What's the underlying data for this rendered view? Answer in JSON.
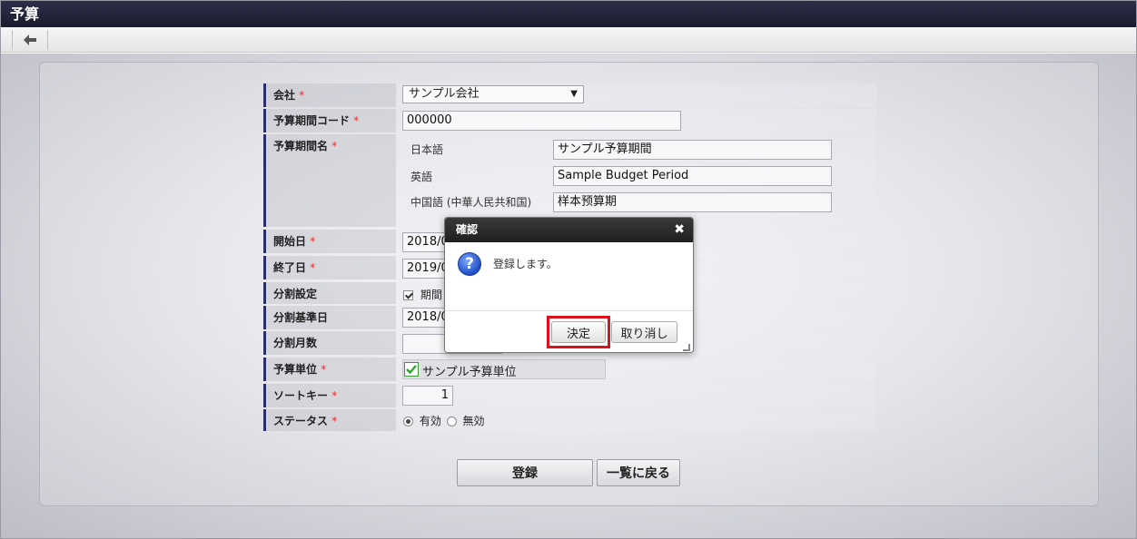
{
  "app": {
    "title": "予算"
  },
  "form": {
    "company": {
      "label": "会社",
      "value": "サンプル会社"
    },
    "period_code": {
      "label": "予算期間コード",
      "value": "000000"
    },
    "period_name": {
      "label": "予算期間名",
      "langs": [
        {
          "lang": "日本語",
          "value": "サンプル予算期間"
        },
        {
          "lang": "英語",
          "value": "Sample Budget Period"
        },
        {
          "lang": "中国語 (中華人民共和国)",
          "value": "样本预算期"
        }
      ]
    },
    "start_date": {
      "label": "開始日",
      "value": "2018/0"
    },
    "end_date": {
      "label": "終了日",
      "value": "2019/0"
    },
    "split_setting": {
      "label": "分割設定",
      "option": "期間"
    },
    "split_base_date": {
      "label": "分割基準日",
      "value": "2018/0"
    },
    "split_months": {
      "label": "分割月数",
      "value": ""
    },
    "budget_unit": {
      "label": "予算単位",
      "value": "サンプル予算単位"
    },
    "sort_key": {
      "label": "ソートキー",
      "value": "1"
    },
    "status": {
      "label": "ステータス",
      "options": [
        "有効",
        "無効"
      ],
      "selected": "有効"
    },
    "required_mark": "*"
  },
  "actions": {
    "register": "登録",
    "back_to_list": "一覧に戻る"
  },
  "dialog": {
    "title": "確認",
    "close_glyph": "✖",
    "message": "登録します。",
    "ok": "決定",
    "cancel": "取り消し"
  },
  "colors": {
    "highlight": "#e0101a",
    "label_bar": "#2a2f6a",
    "required": "#dd3333"
  }
}
